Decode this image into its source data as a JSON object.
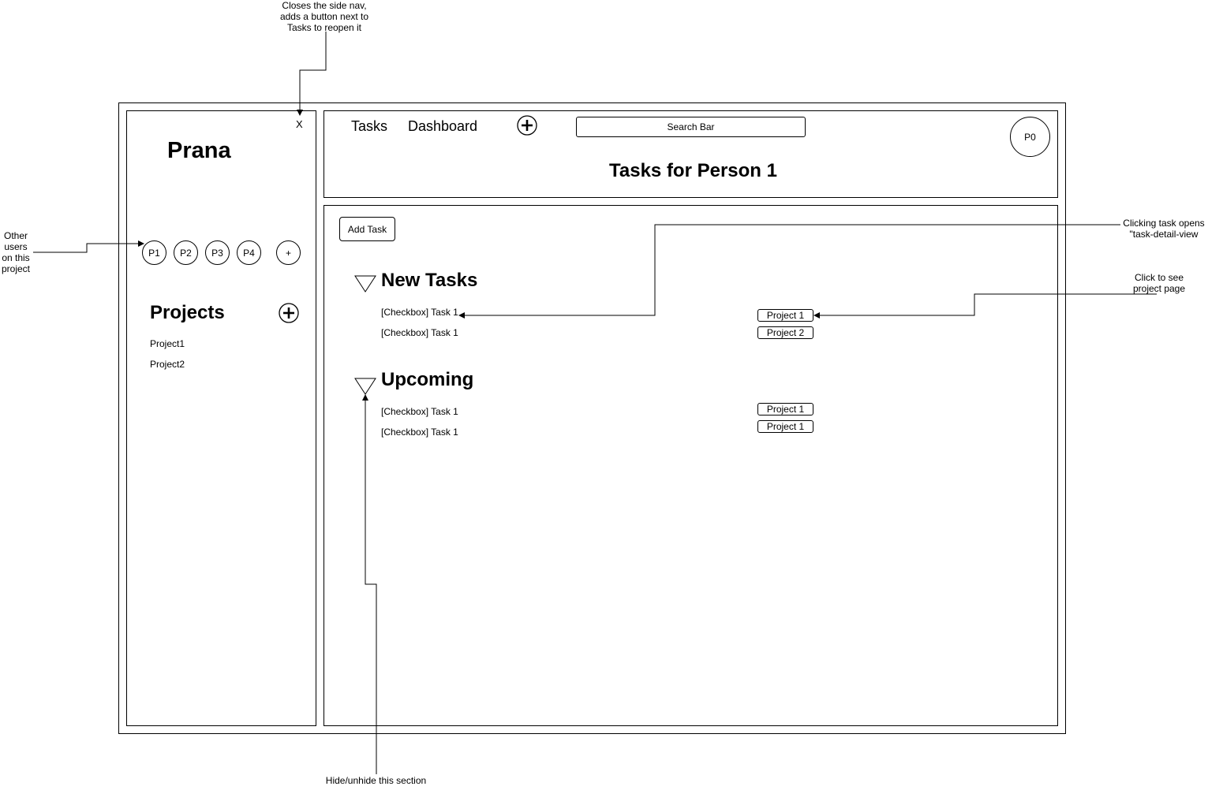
{
  "sidenav": {
    "close_label": "X",
    "brand": "Prana",
    "users": [
      "P1",
      "P2",
      "P3",
      "P4"
    ],
    "add_user_label": "+",
    "projects_title": "Projects",
    "projects": [
      "Project1",
      "Project2"
    ]
  },
  "header": {
    "tabs": [
      "Tasks",
      "Dashboard"
    ],
    "search_label": "Search Bar",
    "profile_label": "P0",
    "page_title": "Tasks for Person 1"
  },
  "main": {
    "add_task_label": "Add Task",
    "sections": [
      {
        "title": "New Tasks",
        "tasks": [
          {
            "label": "[Checkbox] Task 1",
            "project": "Project 1"
          },
          {
            "label": "[Checkbox] Task 1",
            "project": "Project 2"
          }
        ]
      },
      {
        "title": "Upcoming",
        "tasks": [
          {
            "label": "[Checkbox] Task 1",
            "project": "Project 1"
          },
          {
            "label": "[Checkbox] Task 1",
            "project": "Project 1"
          }
        ]
      }
    ]
  },
  "annotations": {
    "close_nav": "Closes the side nav, adds a button next to Tasks to reopen it",
    "other_users": "Other users on this project",
    "task_click": "Clicking task opens \"task-detail-view",
    "project_click": "Click to see project page",
    "hide_section": "Hide/unhide this section"
  }
}
